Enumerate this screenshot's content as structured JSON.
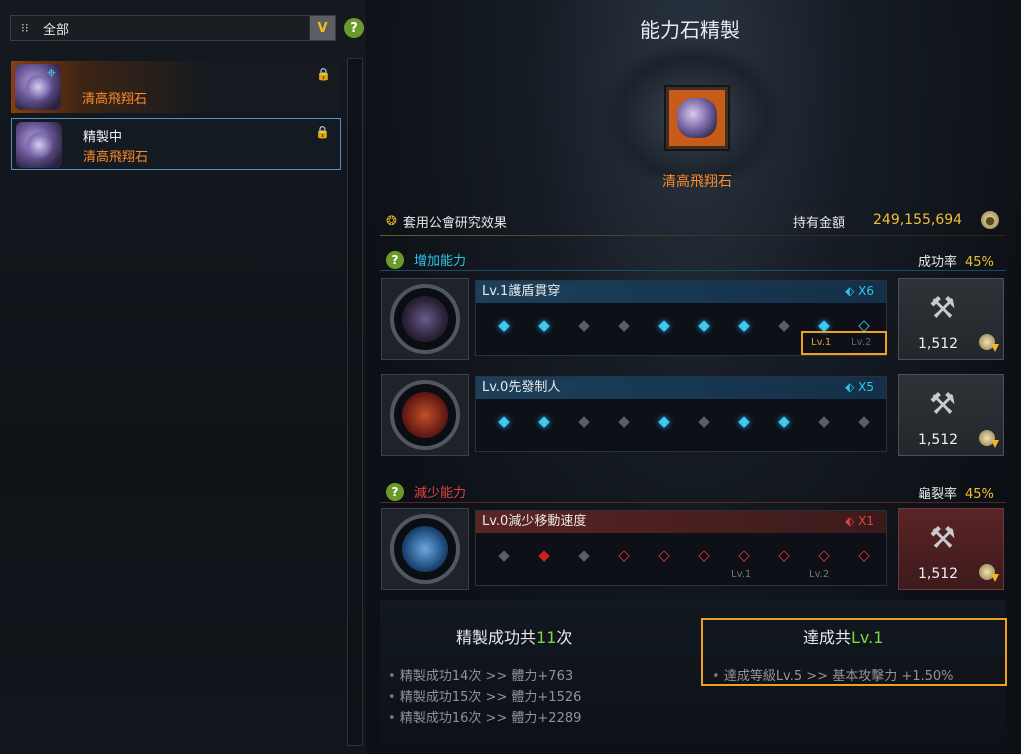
{
  "filter": {
    "label": "全部",
    "dropdown": "V",
    "help": "?"
  },
  "list": [
    {
      "line1": "",
      "line2": "清高飛翔石"
    },
    {
      "line1": "精製中",
      "line2": "清高飛翔石"
    }
  ],
  "header": {
    "title": "能力石精製",
    "stone_name": "清高飛翔石"
  },
  "guild": {
    "label": "套用公會研究效果"
  },
  "money": {
    "label": "持有金額",
    "value": "249,155,694"
  },
  "add_section": {
    "title": "增加能力",
    "rate_label": "成功率",
    "rate": "45%"
  },
  "reduce_section": {
    "title": "減少能力",
    "rate_label": "龜裂率",
    "rate": "45%"
  },
  "rows": [
    {
      "name": "Lv.1護盾貫穿",
      "count": "X6",
      "price": "1,512",
      "lv1": "Lv.1",
      "lv2": "Lv.2"
    },
    {
      "name": "Lv.0先發制人",
      "count": "X5",
      "price": "1,512"
    },
    {
      "name": "Lv.0減少移動速度",
      "count": "X1",
      "price": "1,512",
      "lv1": "Lv.1",
      "lv2": "Lv.2"
    }
  ],
  "bottom": {
    "success_prefix": "精製成功共",
    "success_count": "11",
    "success_suffix": "次",
    "success_items": [
      "精製成功14次 >> 體力+763",
      "精製成功15次 >> 體力+1526",
      "精製成功16次 >> 體力+2289"
    ],
    "achieve_prefix": "達成共",
    "achieve_level": "Lv.1",
    "achieve_item": "達成等級Lv.5 >> 基本攻擊力 +1.50%"
  },
  "colors": {
    "accent_blue": "#2ec5ea",
    "accent_red": "#e0443a",
    "gold": "#f0c030",
    "green": "#7bd83a",
    "orange": "#ff8a2a"
  }
}
